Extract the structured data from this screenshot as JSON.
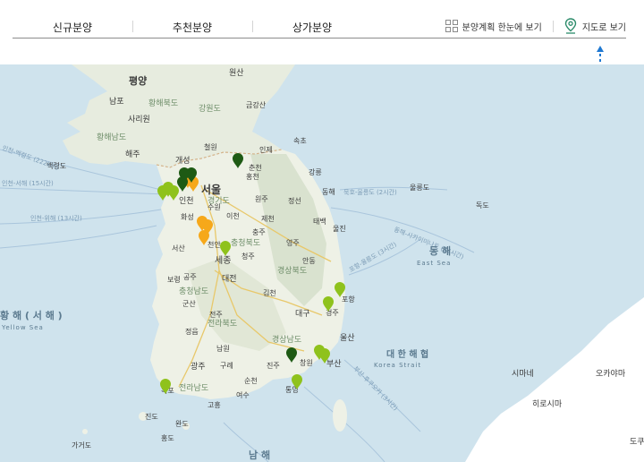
{
  "nav": {
    "tabs": [
      {
        "id": "new",
        "label": "신규분양"
      },
      {
        "id": "recommend",
        "label": "추천분양"
      },
      {
        "id": "commercial",
        "label": "상가분양"
      }
    ],
    "plan_view_label": "분양계획 한눈에 보기",
    "map_view_label": "지도로 보기"
  },
  "map": {
    "seas": [
      {
        "id": "west",
        "label": "황 해 ( 서 해 )",
        "sub": "Yellow Sea"
      },
      {
        "id": "east",
        "label": "동 해",
        "sub": "East Sea"
      },
      {
        "id": "strait",
        "label": "대 한 해 협",
        "sub": "Korea Strait"
      },
      {
        "id": "south",
        "label": "남 해"
      }
    ],
    "north": {
      "capital": "평양",
      "provinces": [
        "황해북도",
        "황해남도",
        "강원도"
      ],
      "cities": [
        "원산",
        "남포",
        "사리원",
        "해주",
        "개성",
        "철원",
        "백령도",
        "금강산"
      ]
    },
    "south_korea": {
      "major_cities": [
        "서울",
        "세종",
        "대전",
        "대구",
        "울산",
        "부산",
        "광주",
        "인천"
      ],
      "cities": [
        "속초",
        "춘천",
        "인제",
        "홍천",
        "강릉",
        "동해",
        "원주",
        "정선",
        "태백",
        "이천",
        "수원",
        "화성",
        "충주",
        "제천",
        "영주",
        "천안",
        "서산",
        "청주",
        "울진",
        "안동",
        "보령",
        "공주",
        "김천",
        "포항",
        "군산",
        "전주",
        "경주",
        "정읍",
        "남원",
        "창원",
        "진주",
        "목포",
        "순천",
        "여수",
        "통영",
        "구례",
        "완도",
        "진도",
        "고흥",
        "가거도",
        "홍도"
      ],
      "provinces": [
        "경기도",
        "충청북도",
        "충청남도",
        "경상북도",
        "경상남도",
        "전라북도",
        "전라남도"
      ]
    },
    "japan": [
      "시마네",
      "오카야마",
      "히로시마",
      "도쿠"
    ],
    "routes": [
      "인천-백령도 (222km)",
      "인천-서해 (15시간)",
      "인천-위해 (13시간)",
      "묵호-울릉도 (2시간)",
      "동해-사카이미나토 (14시간)",
      "포항-울릉도 (3시간)",
      "부산-후쿠오카 (3시간)",
      "독도",
      "울릉도"
    ],
    "marker_colors": {
      "dark": "#1e5a14",
      "green": "#8fc21c",
      "orange": "#f6a81a"
    },
    "markers": [
      {
        "city": "춘천",
        "type": "dark"
      },
      {
        "city": "인천",
        "type": "green"
      },
      {
        "city": "인천",
        "type": "green"
      },
      {
        "city": "인천",
        "type": "green"
      },
      {
        "city": "서울",
        "type": "orange"
      },
      {
        "city": "서울",
        "type": "orange"
      },
      {
        "city": "서울",
        "type": "dark"
      },
      {
        "city": "서울",
        "type": "dark"
      },
      {
        "city": "서울",
        "type": "dark"
      },
      {
        "city": "화성",
        "type": "orange"
      },
      {
        "city": "화성",
        "type": "orange"
      },
      {
        "city": "천안",
        "type": "orange"
      },
      {
        "city": "세종",
        "type": "green"
      },
      {
        "city": "포항",
        "type": "green"
      },
      {
        "city": "경주",
        "type": "green"
      },
      {
        "city": "창원",
        "type": "dark"
      },
      {
        "city": "부산",
        "type": "green"
      },
      {
        "city": "부산",
        "type": "green"
      },
      {
        "city": "통영",
        "type": "green"
      },
      {
        "city": "목포",
        "type": "green"
      }
    ]
  }
}
